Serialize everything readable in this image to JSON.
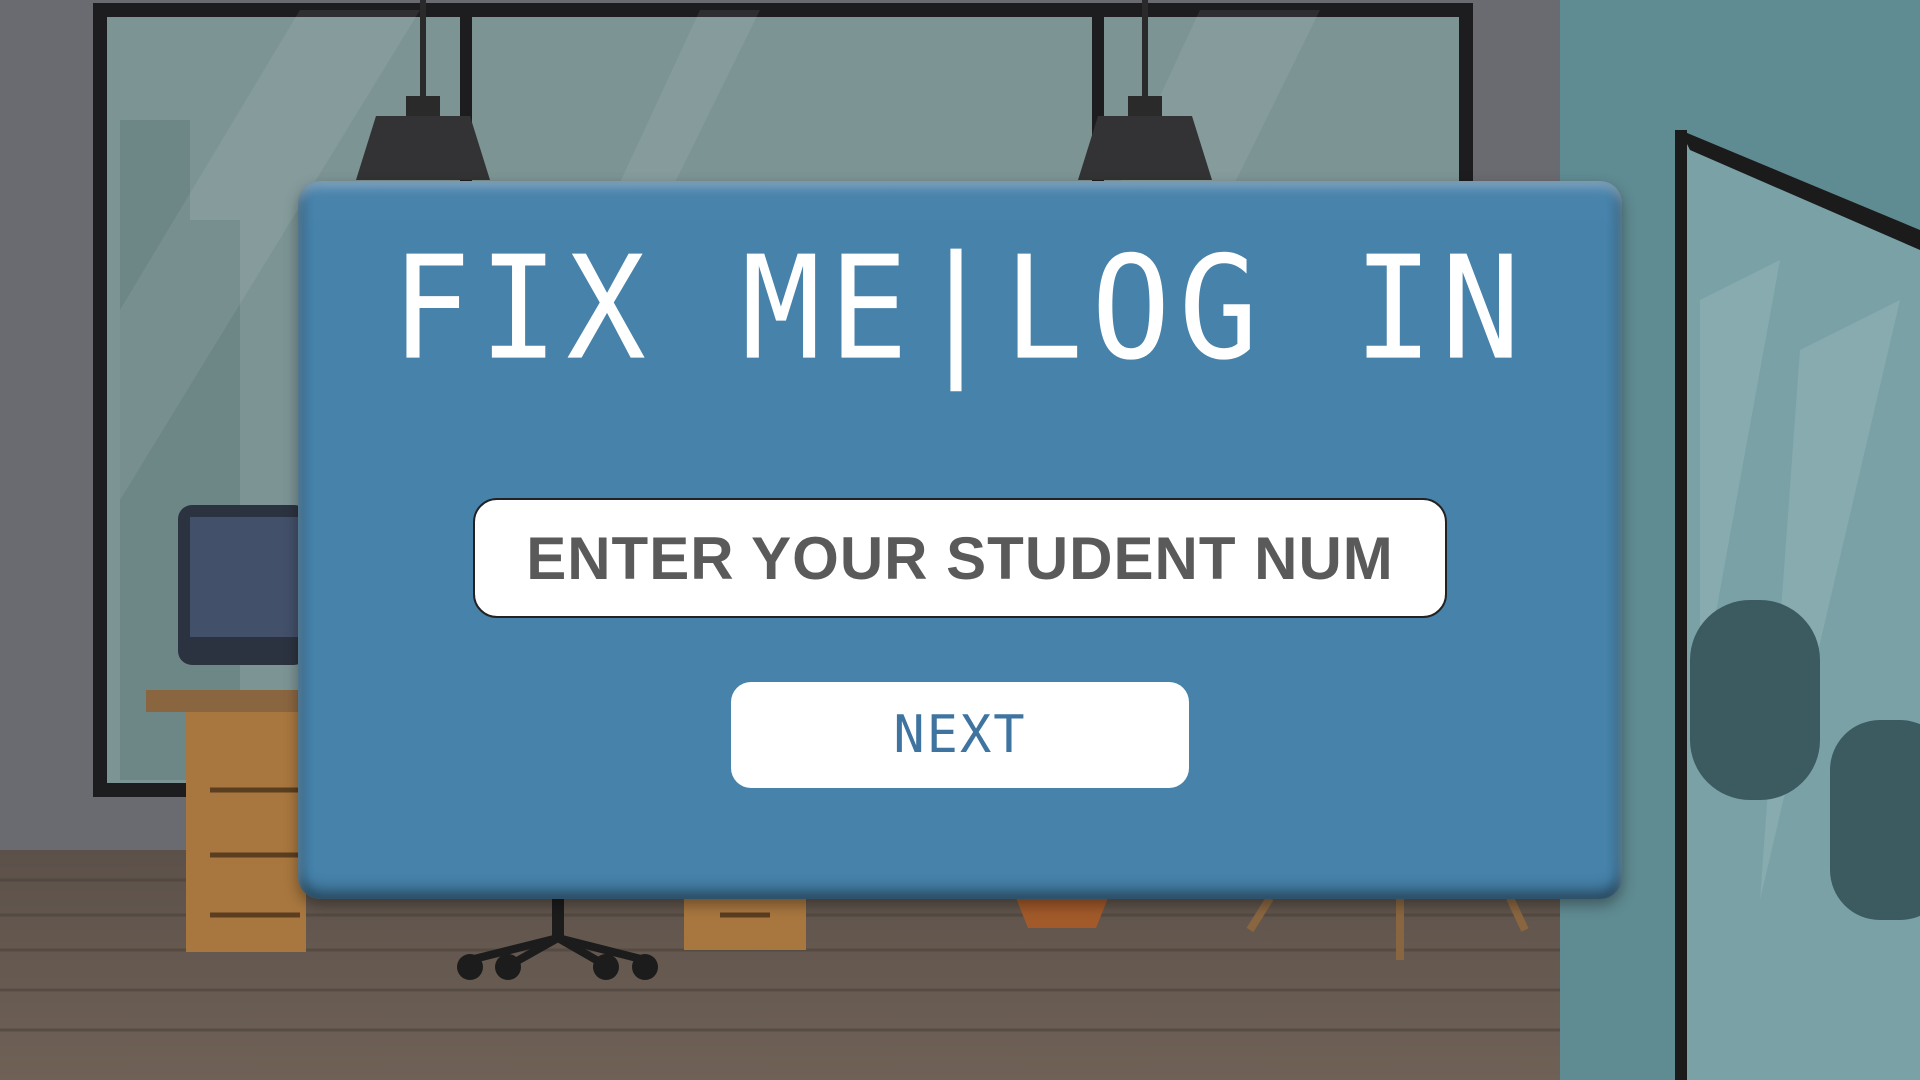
{
  "login": {
    "title": "FIX ME|LOG IN",
    "input_placeholder": "ENTER YOUR STUDENT NUM",
    "input_value": "",
    "next_label": "NEXT"
  },
  "colors": {
    "panel": "#4682aa",
    "title_text": "#ffffff",
    "input_text": "#5a5a5a",
    "button_text": "#3f74a0",
    "wall": "#5f6368",
    "floor": "#6b5e52"
  },
  "background": {
    "description_icon": "office-room-scene"
  }
}
